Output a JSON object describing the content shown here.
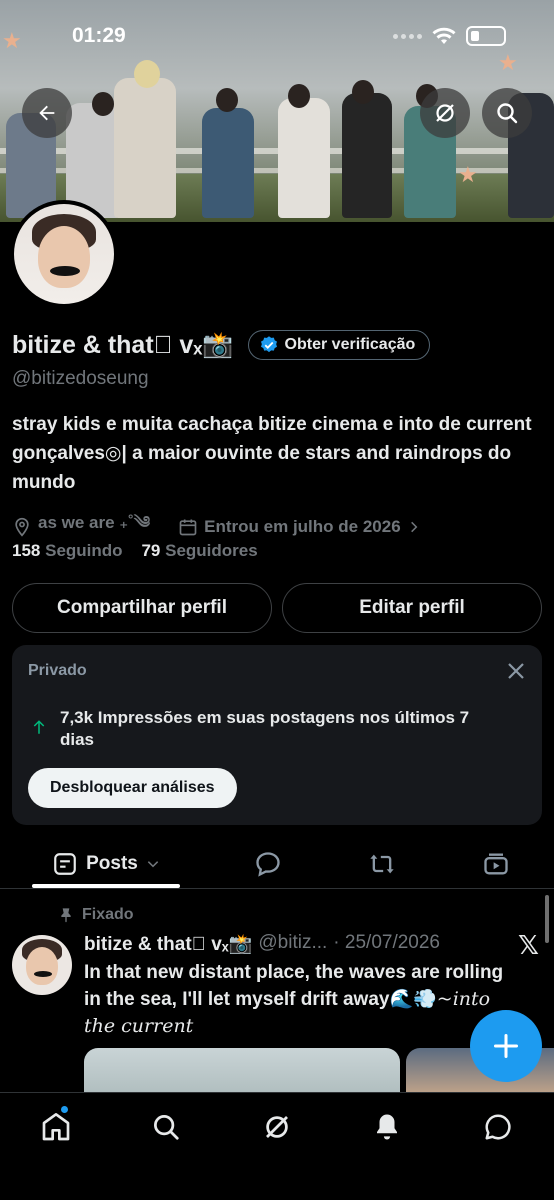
{
  "status_bar": {
    "time": "01:29"
  },
  "profile": {
    "display_name": "bitize & that⃒ ᴠₓ📸",
    "verify_button": "Obter verificação",
    "handle": "@bitizedoseung",
    "bio": "stray kids e muita cachaça bitize cinema e into de current gonçalves◎| a maior ouvinte de stars and raindrops do mundo",
    "location": "as we are ₊˚༄",
    "joined": "Entrou em julho de 2026",
    "following_count": "158",
    "following_label": "Seguindo",
    "followers_count": "79",
    "followers_label": "Seguidores",
    "share_button": "Compartilhar perfil",
    "edit_button": "Editar perfil"
  },
  "analytics_card": {
    "label": "Privado",
    "stat": "7,3k Impressões em suas postagens nos últimos 7 dias",
    "unlock_button": "Desbloquear análises"
  },
  "tabs": {
    "posts_label": "Posts"
  },
  "pinned_post": {
    "pinned_label": "Fixado",
    "author_name": "bitize & that⃒ ᴠₓ📸",
    "author_handle": "@bitiz...",
    "date": "· 25/07/2026",
    "text": "In that new distant place, the waves are rolling in the sea, I'll let myself drift away🌊💨",
    "text_italic": "~into the current"
  },
  "colors": {
    "accent": "#1d9bf0",
    "background": "#000000",
    "muted": "#71767b"
  }
}
